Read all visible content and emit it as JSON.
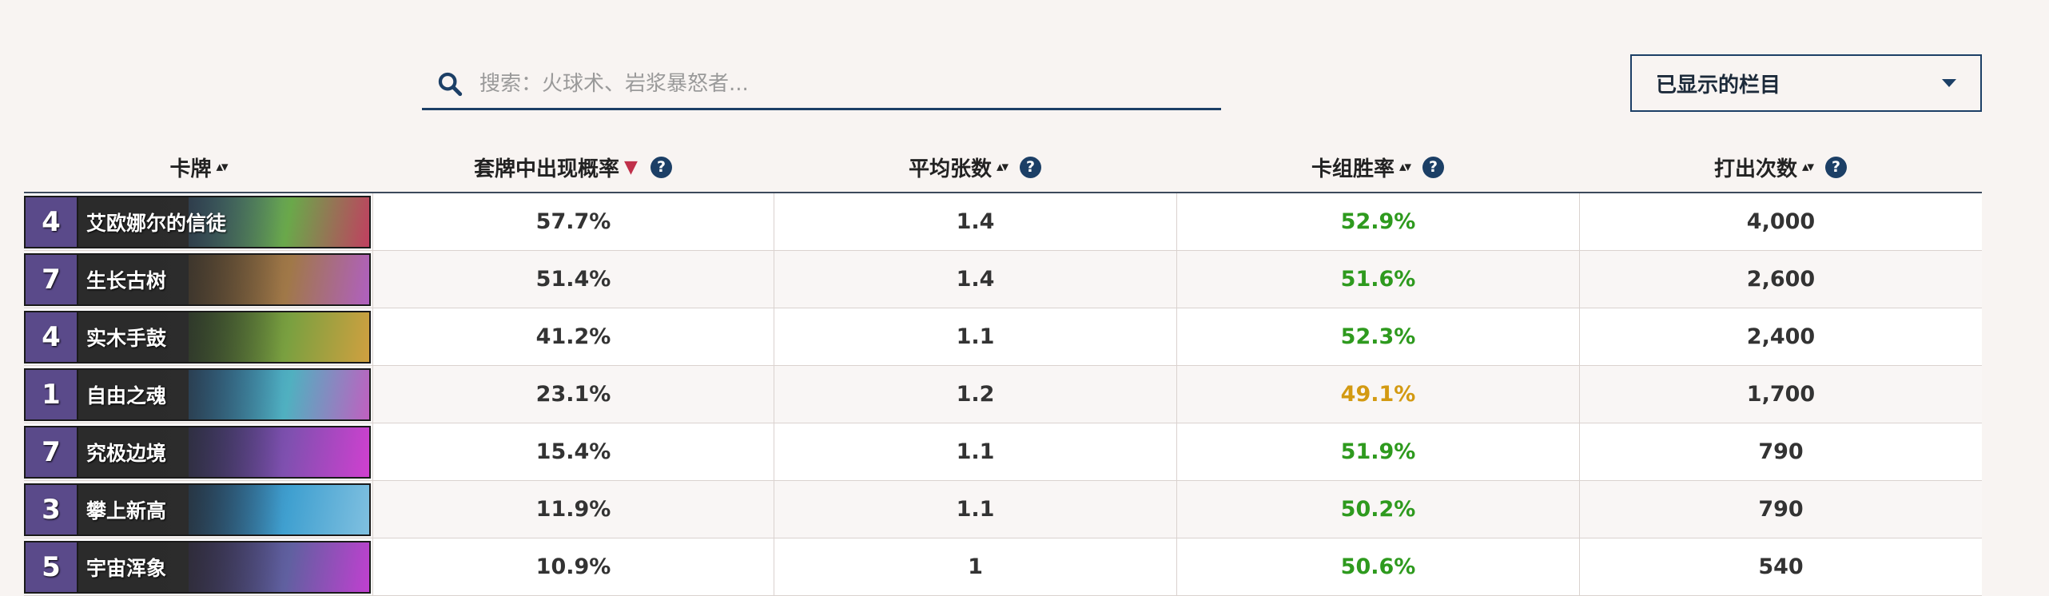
{
  "search": {
    "placeholder": "搜索：火球术、岩浆暴怒者..."
  },
  "columns_button": {
    "label": "已显示的栏目"
  },
  "table": {
    "headers": [
      {
        "label": "卡牌",
        "sort": "▴▾",
        "active": false,
        "help": false
      },
      {
        "label": "套牌中出现概率",
        "sort": "▼",
        "active": true,
        "help": true
      },
      {
        "label": "平均张数",
        "sort": "▴▾",
        "active": false,
        "help": true
      },
      {
        "label": "卡组胜率",
        "sort": "▴▾",
        "active": false,
        "help": true
      },
      {
        "label": "打出次数",
        "sort": "▴▾",
        "active": false,
        "help": true
      }
    ],
    "help_glyph": "?",
    "rows": [
      {
        "cost": "4",
        "name": "艾欧娜尔的信徒",
        "inclusion": "57.7%",
        "avg_copies": "1.4",
        "winrate": "52.9%",
        "winrate_level": "good",
        "played": "4,000",
        "art": [
          "#3a6a9a",
          "#6aa84a",
          "#c04060"
        ]
      },
      {
        "cost": "7",
        "name": "生长古树",
        "inclusion": "51.4%",
        "avg_copies": "1.4",
        "winrate": "51.6%",
        "winrate_level": "good",
        "played": "2,600",
        "art": [
          "#6a5030",
          "#a07848",
          "#b060c0"
        ]
      },
      {
        "cost": "4",
        "name": "实木手鼓",
        "inclusion": "41.2%",
        "avg_copies": "1.1",
        "winrate": "52.3%",
        "winrate_level": "good",
        "played": "2,400",
        "art": [
          "#3a5a2a",
          "#7aa040",
          "#d0a040"
        ]
      },
      {
        "cost": "1",
        "name": "自由之魂",
        "inclusion": "23.1%",
        "avg_copies": "1.2",
        "winrate": "49.1%",
        "winrate_level": "mid",
        "played": "1,700",
        "art": [
          "#2a70b0",
          "#50b0c0",
          "#c060c0"
        ]
      },
      {
        "cost": "7",
        "name": "究极边境",
        "inclusion": "15.4%",
        "avg_copies": "1.1",
        "winrate": "51.9%",
        "winrate_level": "good",
        "played": "790",
        "art": [
          "#3a3a7a",
          "#8050b0",
          "#d040d0"
        ]
      },
      {
        "cost": "3",
        "name": "攀上新高",
        "inclusion": "11.9%",
        "avg_copies": "1.1",
        "winrate": "50.2%",
        "winrate_level": "good",
        "played": "790",
        "art": [
          "#205080",
          "#40a0d0",
          "#80c0e0"
        ]
      },
      {
        "cost": "5",
        "name": "宇宙浑象",
        "inclusion": "10.9%",
        "avg_copies": "1",
        "winrate": "50.6%",
        "winrate_level": "good",
        "played": "540",
        "art": [
          "#3a3060",
          "#6060a0",
          "#c040d0"
        ]
      }
    ]
  },
  "colors": {
    "accent": "#1c3f66",
    "good": "#2e9a1e",
    "mid": "#d39a12",
    "sort_active": "#c0304a",
    "cost_gem": "#5a4a8a"
  }
}
